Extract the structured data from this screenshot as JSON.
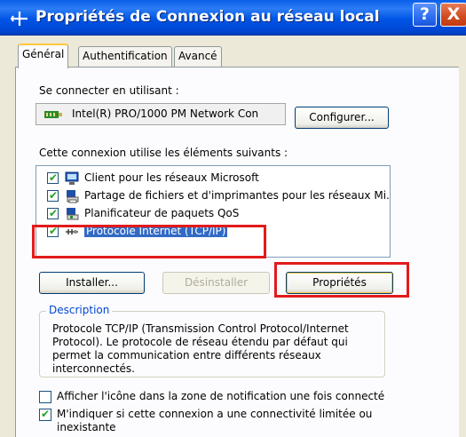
{
  "window": {
    "title": "Propriétés de Connexion au réseau local",
    "help_label": "?",
    "close_label": "X"
  },
  "tabs": [
    {
      "label": "Général",
      "active": true
    },
    {
      "label": "Authentification",
      "active": false
    },
    {
      "label": "Avancé",
      "active": false
    }
  ],
  "connect_using": {
    "label": "Se connecter en utilisant :",
    "adapter_name": "Intel(R) PRO/1000 PM Network Con",
    "configure_button": "Configurer..."
  },
  "components": {
    "label": "Cette connexion utilise les éléments suivants :",
    "items": [
      {
        "label": "Client pour les réseaux Microsoft",
        "checked": true,
        "icon": "network-client-icon"
      },
      {
        "label": "Partage de fichiers et d'imprimantes pour les réseaux Mi...",
        "checked": true,
        "icon": "file-printer-sharing-icon"
      },
      {
        "label": "Planificateur de paquets QoS",
        "checked": true,
        "icon": "qos-scheduler-icon"
      },
      {
        "label": "Protocole Internet (TCP/IP)",
        "checked": true,
        "selected": true,
        "icon": "protocol-icon"
      }
    ]
  },
  "buttons": {
    "install": "Installer...",
    "uninstall": "Désinstaller",
    "properties": "Propriétés"
  },
  "description": {
    "title": "Description",
    "text": "Protocole TCP/IP (Transmission Control Protocol/Internet Protocol). Le protocole de réseau étendu par défaut qui permet la communication entre différents réseaux interconnectés."
  },
  "options": {
    "show_icon": {
      "label": "Afficher l'icône dans la zone de notification une fois connecté",
      "checked": false
    },
    "notify_limited_line1": "M'indiquer si cette connexion a une connectivité limitée ou",
    "notify_limited_line2": "inexistante",
    "notify_limited_checked": true
  },
  "colors": {
    "titlebar": "#0055e5",
    "selection": "#316ac5",
    "highlight_box": "#e21b1b",
    "group_title": "#0046d5"
  }
}
